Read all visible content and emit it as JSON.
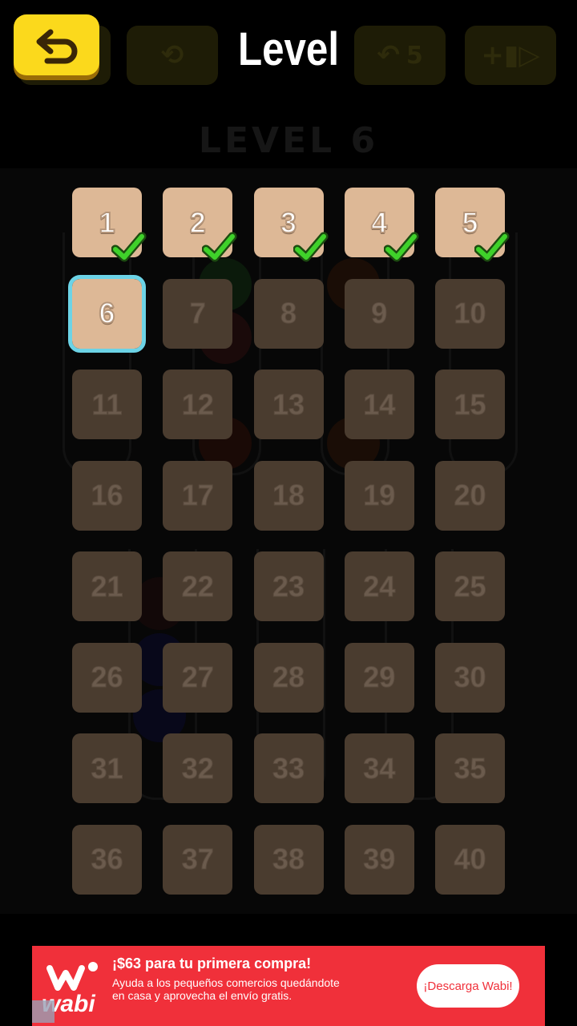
{
  "header": {
    "title": "Level",
    "back_icon": "back-arrow-icon"
  },
  "background_game": {
    "level_label": "LEVEL 6",
    "undo_count": "5",
    "toolbar_icons": [
      "restart-icon",
      "undo-icon",
      "add-tube-video-icon"
    ]
  },
  "levels": [
    {
      "n": "1",
      "state": "completed"
    },
    {
      "n": "2",
      "state": "completed"
    },
    {
      "n": "3",
      "state": "completed"
    },
    {
      "n": "4",
      "state": "completed"
    },
    {
      "n": "5",
      "state": "completed"
    },
    {
      "n": "6",
      "state": "current"
    },
    {
      "n": "7",
      "state": "locked"
    },
    {
      "n": "8",
      "state": "locked"
    },
    {
      "n": "9",
      "state": "locked"
    },
    {
      "n": "10",
      "state": "locked"
    },
    {
      "n": "11",
      "state": "locked"
    },
    {
      "n": "12",
      "state": "locked"
    },
    {
      "n": "13",
      "state": "locked"
    },
    {
      "n": "14",
      "state": "locked"
    },
    {
      "n": "15",
      "state": "locked"
    },
    {
      "n": "16",
      "state": "locked"
    },
    {
      "n": "17",
      "state": "locked"
    },
    {
      "n": "18",
      "state": "locked"
    },
    {
      "n": "19",
      "state": "locked"
    },
    {
      "n": "20",
      "state": "locked"
    },
    {
      "n": "21",
      "state": "locked"
    },
    {
      "n": "22",
      "state": "locked"
    },
    {
      "n": "23",
      "state": "locked"
    },
    {
      "n": "24",
      "state": "locked"
    },
    {
      "n": "25",
      "state": "locked"
    },
    {
      "n": "26",
      "state": "locked"
    },
    {
      "n": "27",
      "state": "locked"
    },
    {
      "n": "28",
      "state": "locked"
    },
    {
      "n": "29",
      "state": "locked"
    },
    {
      "n": "30",
      "state": "locked"
    },
    {
      "n": "31",
      "state": "locked"
    },
    {
      "n": "32",
      "state": "locked"
    },
    {
      "n": "33",
      "state": "locked"
    },
    {
      "n": "34",
      "state": "locked"
    },
    {
      "n": "35",
      "state": "locked"
    },
    {
      "n": "36",
      "state": "locked"
    },
    {
      "n": "37",
      "state": "locked"
    },
    {
      "n": "38",
      "state": "locked"
    },
    {
      "n": "39",
      "state": "locked"
    },
    {
      "n": "40",
      "state": "locked"
    }
  ],
  "ad": {
    "brand": "wabi",
    "title": "¡$63 para tu primera compra!",
    "body": "Ayuda a los pequeños comercios quedándote en casa y aprovecha el envío gratis.",
    "cta": "¡Descarga Wabi!",
    "colors": {
      "background": "#f0303a",
      "button": "#ffffff"
    }
  },
  "colors": {
    "back_button": "#fbd91c",
    "tile_unlocked": "#ddb896",
    "tile_locked": "#4a3c2f",
    "current_outline": "#6cd3e6",
    "check": "#3fd12a"
  }
}
